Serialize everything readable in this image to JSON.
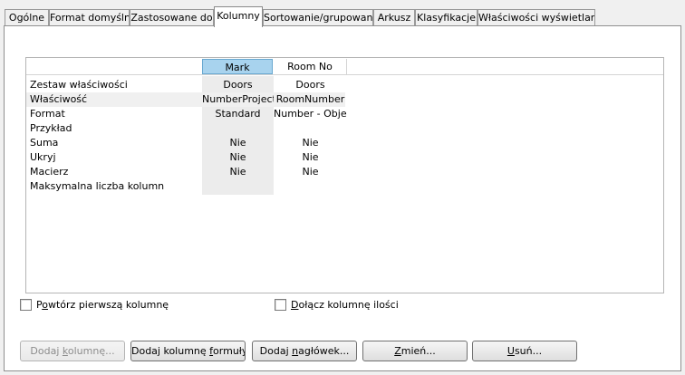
{
  "tabs": [
    {
      "label": "Ogólne"
    },
    {
      "label": "Format domyślny"
    },
    {
      "label": "Zastosowane do"
    },
    {
      "label": "Kolumny",
      "active": true
    },
    {
      "label": "Sortowanie/grupowanie"
    },
    {
      "label": "Arkusz"
    },
    {
      "label": "Klasyfikacje"
    },
    {
      "label": "Właściwości wyświetlania"
    }
  ],
  "grid": {
    "columns": [
      {
        "label": "Mark",
        "selected": true
      },
      {
        "label": "Room No",
        "selected": false
      }
    ],
    "rows": [
      {
        "label": "Zestaw właściwości",
        "values": [
          "Doors",
          "Doors"
        ]
      },
      {
        "label": "Właściwość",
        "values": [
          "NumberProject",
          "RoomNumber"
        ]
      },
      {
        "label": "Format",
        "values": [
          "Standard",
          "Number - Object"
        ]
      },
      {
        "label": "Przykład",
        "values": [
          "",
          ""
        ]
      },
      {
        "label": "Suma",
        "values": [
          "Nie",
          "Nie"
        ]
      },
      {
        "label": "Ukryj",
        "values": [
          "Nie",
          "Nie"
        ]
      },
      {
        "label": "Macierz",
        "values": [
          "Nie",
          "Nie"
        ]
      },
      {
        "label": "Maksymalna liczba kolumn",
        "values": [
          "",
          ""
        ]
      }
    ]
  },
  "options": {
    "repeat_first": {
      "pre": "P",
      "accel": "o",
      "post": "wtórz pierwszą kolumnę",
      "checked": false
    },
    "add_quantity": {
      "pre": "",
      "accel": "D",
      "post": "ołącz kolumnę ilości",
      "checked": false
    }
  },
  "buttons": {
    "add_column": {
      "pre": "Dodaj ",
      "accel": "k",
      "post": "olumnę...",
      "enabled": false
    },
    "add_formula": {
      "pre": "Dodaj kolumnę ",
      "accel": "f",
      "post": "ormuły...",
      "enabled": true
    },
    "add_header": {
      "pre": "Dodaj ",
      "accel": "n",
      "post": "agłówek...",
      "enabled": true
    },
    "modify": {
      "pre": "",
      "accel": "Z",
      "post": "mień...",
      "enabled": true
    },
    "delete": {
      "pre": "",
      "accel": "U",
      "post": "suń...",
      "enabled": true
    }
  }
}
